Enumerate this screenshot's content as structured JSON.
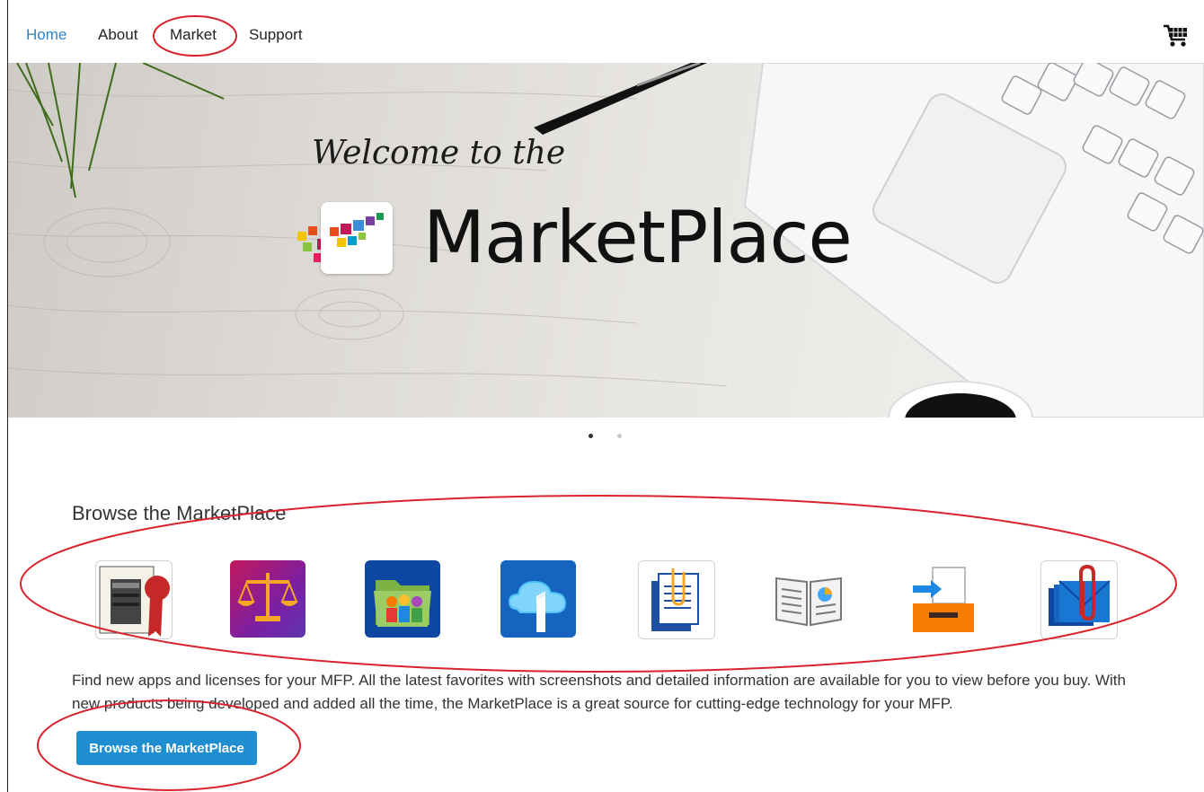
{
  "nav": {
    "items": [
      {
        "label": "Home",
        "active": true
      },
      {
        "label": "About",
        "active": false
      },
      {
        "label": "Market",
        "active": false
      },
      {
        "label": "Support",
        "active": false
      }
    ],
    "cart_icon": "shopping-cart-icon"
  },
  "hero": {
    "welcome": "Welcome to the",
    "brand": "MarketPlace",
    "slides": 2,
    "active_slide": 1
  },
  "browse": {
    "title": "Browse the MarketPlace",
    "apps": [
      {
        "icon": "certificate-printer-icon"
      },
      {
        "icon": "balance-scale-icon"
      },
      {
        "icon": "shared-folder-icon"
      },
      {
        "icon": "cloud-one-icon"
      },
      {
        "icon": "clipped-documents-icon"
      },
      {
        "icon": "open-book-report-icon"
      },
      {
        "icon": "inbox-tray-icon"
      },
      {
        "icon": "mail-attachment-icon"
      }
    ],
    "description": "Find new apps and licenses for your MFP. All the latest favorites with screenshots and detailed information are available for you to view before you buy. With new products being developed and added all the time, the MarketPlace is a great source for cutting-edge technology for your MFP.",
    "button_label": "Browse the MarketPlace"
  },
  "colors": {
    "accent": "#1f8ed0",
    "nav_active": "#2e86c1",
    "annotation": "#d9232d"
  }
}
